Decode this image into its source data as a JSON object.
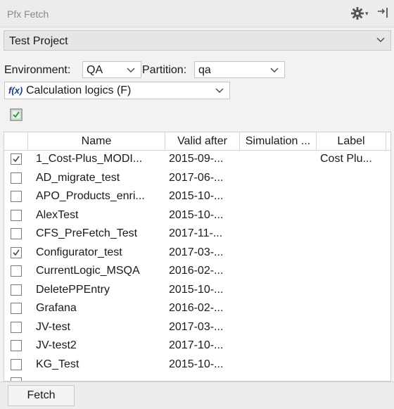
{
  "panel": {
    "title": "Pfx Fetch"
  },
  "icons": {
    "settings": "gear-icon",
    "pin": "pin-icon",
    "expand": "chevron-down-icon",
    "function": "function-icon",
    "select_all": "checkbox-icon"
  },
  "project": {
    "selected": "Test Project"
  },
  "filters": {
    "environment_label": "Environment:",
    "environment_value": "QA",
    "partition_label": "Partition:",
    "partition_value": "qa",
    "logic_icon_text": "f(x)",
    "logic_value": "Calculation logics (F)"
  },
  "table": {
    "columns": [
      "Name",
      "Valid after",
      "Simulation ...",
      "Label"
    ],
    "rows": [
      {
        "checked": true,
        "name": "1_Cost-Plus_MODI...",
        "valid_after": "2015-09-...",
        "simulation": "",
        "label": "Cost Plu..."
      },
      {
        "checked": false,
        "name": "AD_migrate_test",
        "valid_after": "2017-06-...",
        "simulation": "",
        "label": ""
      },
      {
        "checked": false,
        "name": "APO_Products_enri...",
        "valid_after": "2015-10-...",
        "simulation": "",
        "label": ""
      },
      {
        "checked": false,
        "name": "AlexTest",
        "valid_after": "2015-10-...",
        "simulation": "",
        "label": ""
      },
      {
        "checked": false,
        "name": "CFS_PreFetch_Test",
        "valid_after": "2017-11-...",
        "simulation": "",
        "label": ""
      },
      {
        "checked": true,
        "name": "Configurator_test",
        "valid_after": "2017-03-...",
        "simulation": "",
        "label": ""
      },
      {
        "checked": false,
        "name": "CurrentLogic_MSQA",
        "valid_after": "2016-02-...",
        "simulation": "",
        "label": ""
      },
      {
        "checked": false,
        "name": "DeletePPEntry",
        "valid_after": "2015-10-...",
        "simulation": "",
        "label": ""
      },
      {
        "checked": false,
        "name": "Grafana",
        "valid_after": "2016-02-...",
        "simulation": "",
        "label": ""
      },
      {
        "checked": false,
        "name": "JV-test",
        "valid_after": "2017-03-...",
        "simulation": "",
        "label": ""
      },
      {
        "checked": false,
        "name": "JV-test2",
        "valid_after": "2017-10-...",
        "simulation": "",
        "label": ""
      },
      {
        "checked": false,
        "name": "KG_Test",
        "valid_after": "2015-10-...",
        "simulation": "",
        "label": ""
      },
      {
        "checked": false,
        "name": "",
        "valid_after": "",
        "simulation": "",
        "label": ""
      }
    ]
  },
  "footer": {
    "fetch_label": "Fetch"
  },
  "colors": {
    "accent_check": "#4a4a4a",
    "green_check": "#2e9e3a",
    "fx_blue": "#1c3c8a"
  }
}
